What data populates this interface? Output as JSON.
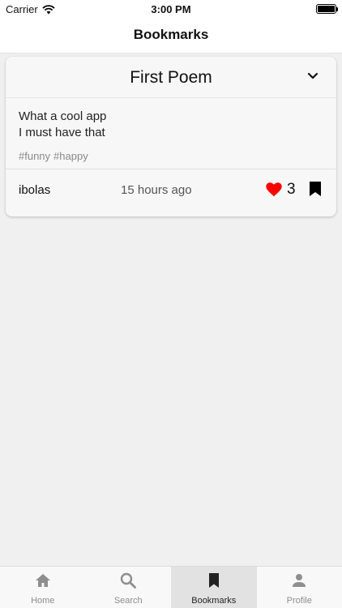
{
  "status_bar": {
    "carrier": "Carrier",
    "time": "3:00 PM"
  },
  "header": {
    "title": "Bookmarks"
  },
  "bookmarks": [
    {
      "title": "First Poem",
      "lines": [
        "What a cool app",
        "I must have that"
      ],
      "tags": [
        "#funny",
        "#happy"
      ],
      "author": "ibolas",
      "time_ago": "15 hours ago",
      "likes": "3",
      "liked": true,
      "bookmarked": true
    }
  ],
  "tabbar": {
    "active": "bookmarks",
    "items": [
      {
        "label": "Home",
        "icon": "home-icon"
      },
      {
        "label": "Search",
        "icon": "search-icon"
      },
      {
        "label": "Bookmarks",
        "icon": "bookmark-icon"
      },
      {
        "label": "Profile",
        "icon": "person-icon"
      }
    ]
  },
  "colors": {
    "accent_like": "#ff0000",
    "active_tab_bg": "#e2e2e2",
    "inactive_tab_icon": "#8e8e8e",
    "active_tab_icon": "#222222"
  }
}
